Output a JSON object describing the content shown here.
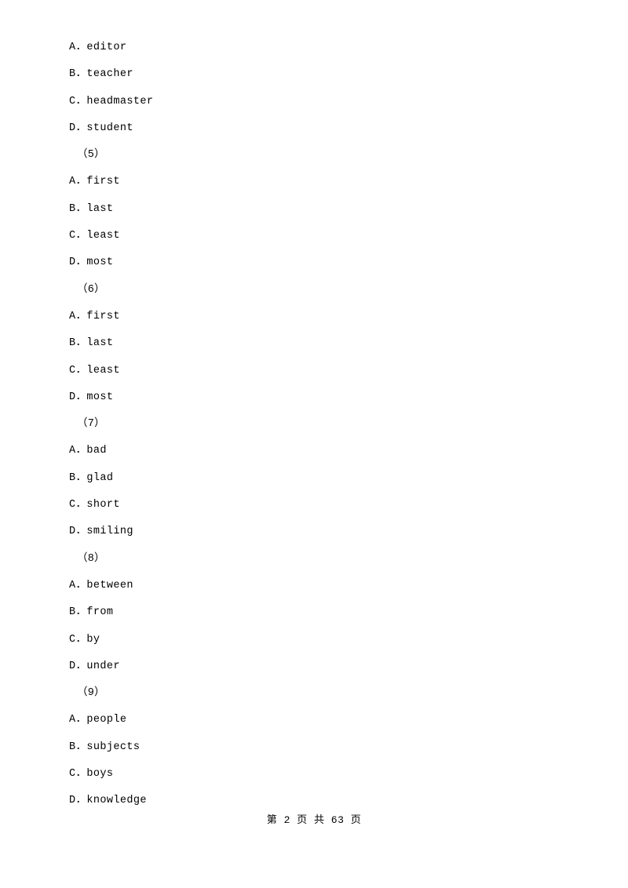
{
  "document": {
    "lines": [
      {
        "text": "A．editor",
        "type": "option"
      },
      {
        "text": "B．teacher",
        "type": "option"
      },
      {
        "text": "C．headmaster",
        "type": "option"
      },
      {
        "text": "D．student",
        "type": "option"
      },
      {
        "text": "（5）",
        "type": "group"
      },
      {
        "text": "A．first",
        "type": "option"
      },
      {
        "text": "B．last",
        "type": "option"
      },
      {
        "text": "C．least",
        "type": "option"
      },
      {
        "text": "D．most",
        "type": "option"
      },
      {
        "text": "（6）",
        "type": "group"
      },
      {
        "text": "A．first",
        "type": "option"
      },
      {
        "text": "B．last",
        "type": "option"
      },
      {
        "text": "C．least",
        "type": "option"
      },
      {
        "text": "D．most",
        "type": "option"
      },
      {
        "text": "（7）",
        "type": "group"
      },
      {
        "text": "A．bad",
        "type": "option"
      },
      {
        "text": "B．glad",
        "type": "option"
      },
      {
        "text": "C．short",
        "type": "option"
      },
      {
        "text": "D．smiling",
        "type": "option"
      },
      {
        "text": "（8）",
        "type": "group"
      },
      {
        "text": "A．between",
        "type": "option"
      },
      {
        "text": "B．from",
        "type": "option"
      },
      {
        "text": "C．by",
        "type": "option"
      },
      {
        "text": "D．under",
        "type": "option"
      },
      {
        "text": "（9）",
        "type": "group"
      },
      {
        "text": "A．people",
        "type": "option"
      },
      {
        "text": "B．subjects",
        "type": "option"
      },
      {
        "text": "C．boys",
        "type": "option"
      },
      {
        "text": "D．knowledge",
        "type": "option"
      }
    ],
    "footer": "第 2 页 共 63 页"
  }
}
